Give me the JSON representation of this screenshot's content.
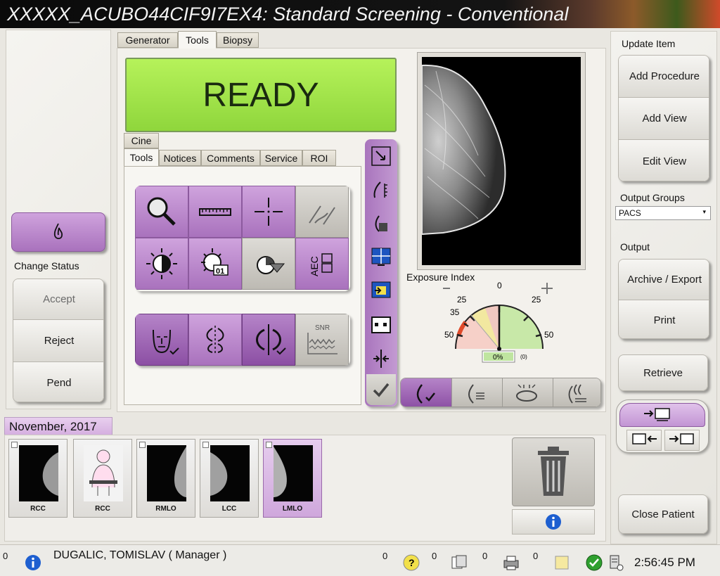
{
  "title": "XXXXX_ACUBO44CIF9I7EX4:  Standard Screening - Conventional",
  "main_tabs": [
    "Generator",
    "Tools",
    "Biopsy"
  ],
  "status": "READY",
  "sub_tabs": {
    "cine": "Cine",
    "items": [
      "Tools",
      "Notices",
      "Comments",
      "Service",
      "ROI"
    ]
  },
  "tool_icons": {
    "magnifier": "magnifier-icon",
    "ruler": "ruler-icon",
    "crosshair": "crosshair-icon",
    "annotate": "annotate-icon",
    "contrast": "contrast-icon",
    "brightness_preset": "brightness-preset-icon",
    "window_level": "window-level-icon",
    "aec": "AEC",
    "preset_value": "01",
    "snr": "SNR"
  },
  "exposure": {
    "label": "Exposure Index",
    "ticks": [
      "25",
      "35",
      "50",
      "0",
      "25",
      "50"
    ],
    "value": "0%",
    "count": "(0)"
  },
  "left": {
    "change_status": "Change Status",
    "accept": "Accept",
    "reject": "Reject",
    "pend": "Pend"
  },
  "right": {
    "update_item": "Update Item",
    "add_procedure": "Add Procedure",
    "add_view": "Add View",
    "edit_view": "Edit View",
    "output_groups": "Output Groups",
    "output_group_value": "PACS",
    "output": "Output",
    "archive_export": "Archive / Export",
    "print": "Print",
    "retrieve": "Retrieve",
    "close_patient": "Close Patient"
  },
  "date_label": "November, 2017",
  "thumbnails": [
    "RCC",
    "RCC",
    "RMLO",
    "LCC",
    "LMLO"
  ],
  "statusbar": {
    "left_num": "0",
    "user": "DUGALIC, TOMISLAV ( Manager )",
    "counts": [
      "0",
      "0",
      "0",
      "0"
    ],
    "time": "2:56:45 PM"
  },
  "colors": {
    "ready_green": "#9ee04a",
    "accent_purple": "#b07cc4",
    "title_bg": "#0a0a0a"
  }
}
